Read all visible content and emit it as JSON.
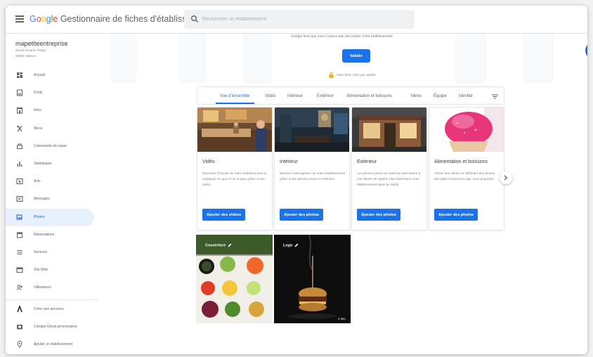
{
  "brand": {
    "google_letters": [
      {
        "ch": "G",
        "color": "#4285F4"
      },
      {
        "ch": "o",
        "color": "#EA4335"
      },
      {
        "ch": "o",
        "color": "#FBBC05"
      },
      {
        "ch": "g",
        "color": "#4285F4"
      },
      {
        "ch": "l",
        "color": "#34A853"
      },
      {
        "ch": "e",
        "color": "#EA4335"
      }
    ],
    "product": "Gestionnaire de fiches d'établissement"
  },
  "search": {
    "placeholder": "Rechercher un établissement"
  },
  "business": {
    "name": "mapetiteentreprise",
    "address_line1": "26 rue frederic chopin",
    "address_line2": "26000 Valence"
  },
  "sidebar": {
    "items": [
      {
        "label": "Accueil",
        "icon": "dashboard-icon"
      },
      {
        "label": "Posts",
        "icon": "posts-icon"
      },
      {
        "label": "Infos",
        "icon": "store-info-icon"
      },
      {
        "label": "Menu",
        "icon": "menu-utensils-icon"
      },
      {
        "label": "Commande de repas",
        "icon": "food-order-icon"
      },
      {
        "label": "Statistiques",
        "icon": "statistics-icon"
      },
      {
        "label": "Avis",
        "icon": "reviews-icon"
      },
      {
        "label": "Messages",
        "icon": "messages-icon"
      },
      {
        "label": "Photos",
        "icon": "photos-icon",
        "active": true
      },
      {
        "label": "Réservations",
        "icon": "reservations-icon"
      },
      {
        "label": "Services",
        "icon": "services-icon"
      },
      {
        "label": "Site Web",
        "icon": "website-icon"
      },
      {
        "label": "Utilisateurs",
        "icon": "users-icon"
      }
    ],
    "bottom_items": [
      {
        "label": "Créer une annonce",
        "icon": "ads-icon"
      },
      {
        "label": "Compte Gmail personnalisé",
        "icon": "gmail-icon"
      },
      {
        "label": "Ajouter un établissement",
        "icon": "add-location-icon"
      }
    ]
  },
  "verify": {
    "text": "Google tient que vous n'aurez pas fait valider votre établissement.",
    "button": "Valider",
    "lock_text": "Votre fiche n'est pas validée"
  },
  "tabs": [
    {
      "label": "Vue d'ensemble",
      "active": true
    },
    {
      "label": "Vidéo"
    },
    {
      "label": "Intérieur"
    },
    {
      "label": "Extérieur"
    },
    {
      "label": "Alimentation et boissons"
    },
    {
      "label": "Menu"
    },
    {
      "label": "Équipe"
    },
    {
      "label": "Identité"
    }
  ],
  "cards": [
    {
      "title": "Vidéo",
      "description": "Racontez l'histoire de votre établissement et expliquez en quoi il est unique grâce à une vidéo.",
      "button": "Ajouter des vidéos"
    },
    {
      "title": "Intérieur",
      "description": "Montrez l'atmosphère de votre établissement grâce à des photos prises en intérieur.",
      "button": "Ajouter des photos"
    },
    {
      "title": "Extérieur",
      "description": "Les photos prises en extérieur permettent à vos clients de repérer plus facilement votre établissement dans la réalité.",
      "button": "Ajouter des photos"
    },
    {
      "title": "Alimentation et boissons",
      "description": "Attirez des clients en affichant des photos des plats et boissons que vous proposez.",
      "button": "Ajouter des photos"
    }
  ],
  "featured": [
    {
      "label": "Couverture"
    },
    {
      "label": "Logo",
      "duration": "1 sec."
    }
  ],
  "colors": {
    "accent": "#1a73e8",
    "active_bg": "#e8f0fe",
    "active_text": "#1967d2"
  }
}
